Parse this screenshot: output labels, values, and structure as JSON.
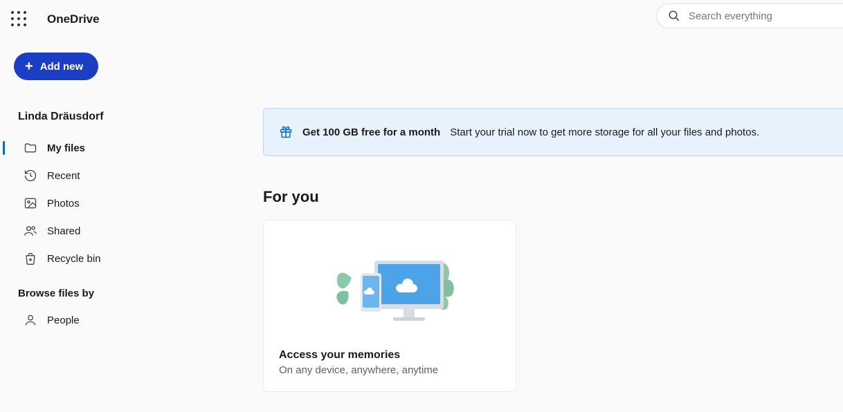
{
  "header": {
    "app_title": "OneDrive",
    "search_placeholder": "Search everything"
  },
  "sidebar": {
    "add_new_label": "Add new",
    "user_name": "Linda Dräusdorf",
    "nav_items": [
      {
        "label": "My files",
        "icon": "folder-icon",
        "active": true
      },
      {
        "label": "Recent",
        "icon": "history-icon",
        "active": false
      },
      {
        "label": "Photos",
        "icon": "image-icon",
        "active": false
      },
      {
        "label": "Shared",
        "icon": "people-icon",
        "active": false
      },
      {
        "label": "Recycle bin",
        "icon": "trash-icon",
        "active": false
      }
    ],
    "browse_heading": "Browse files by",
    "browse_items": [
      {
        "label": "People",
        "icon": "person-icon"
      }
    ]
  },
  "main": {
    "promo": {
      "title": "Get 100 GB free for a month",
      "subtitle": "Start your trial now to get more storage for all your files and photos."
    },
    "for_you_heading": "For you",
    "card": {
      "title": "Access your memories",
      "subtitle": "On any device, anywhere, anytime"
    }
  }
}
